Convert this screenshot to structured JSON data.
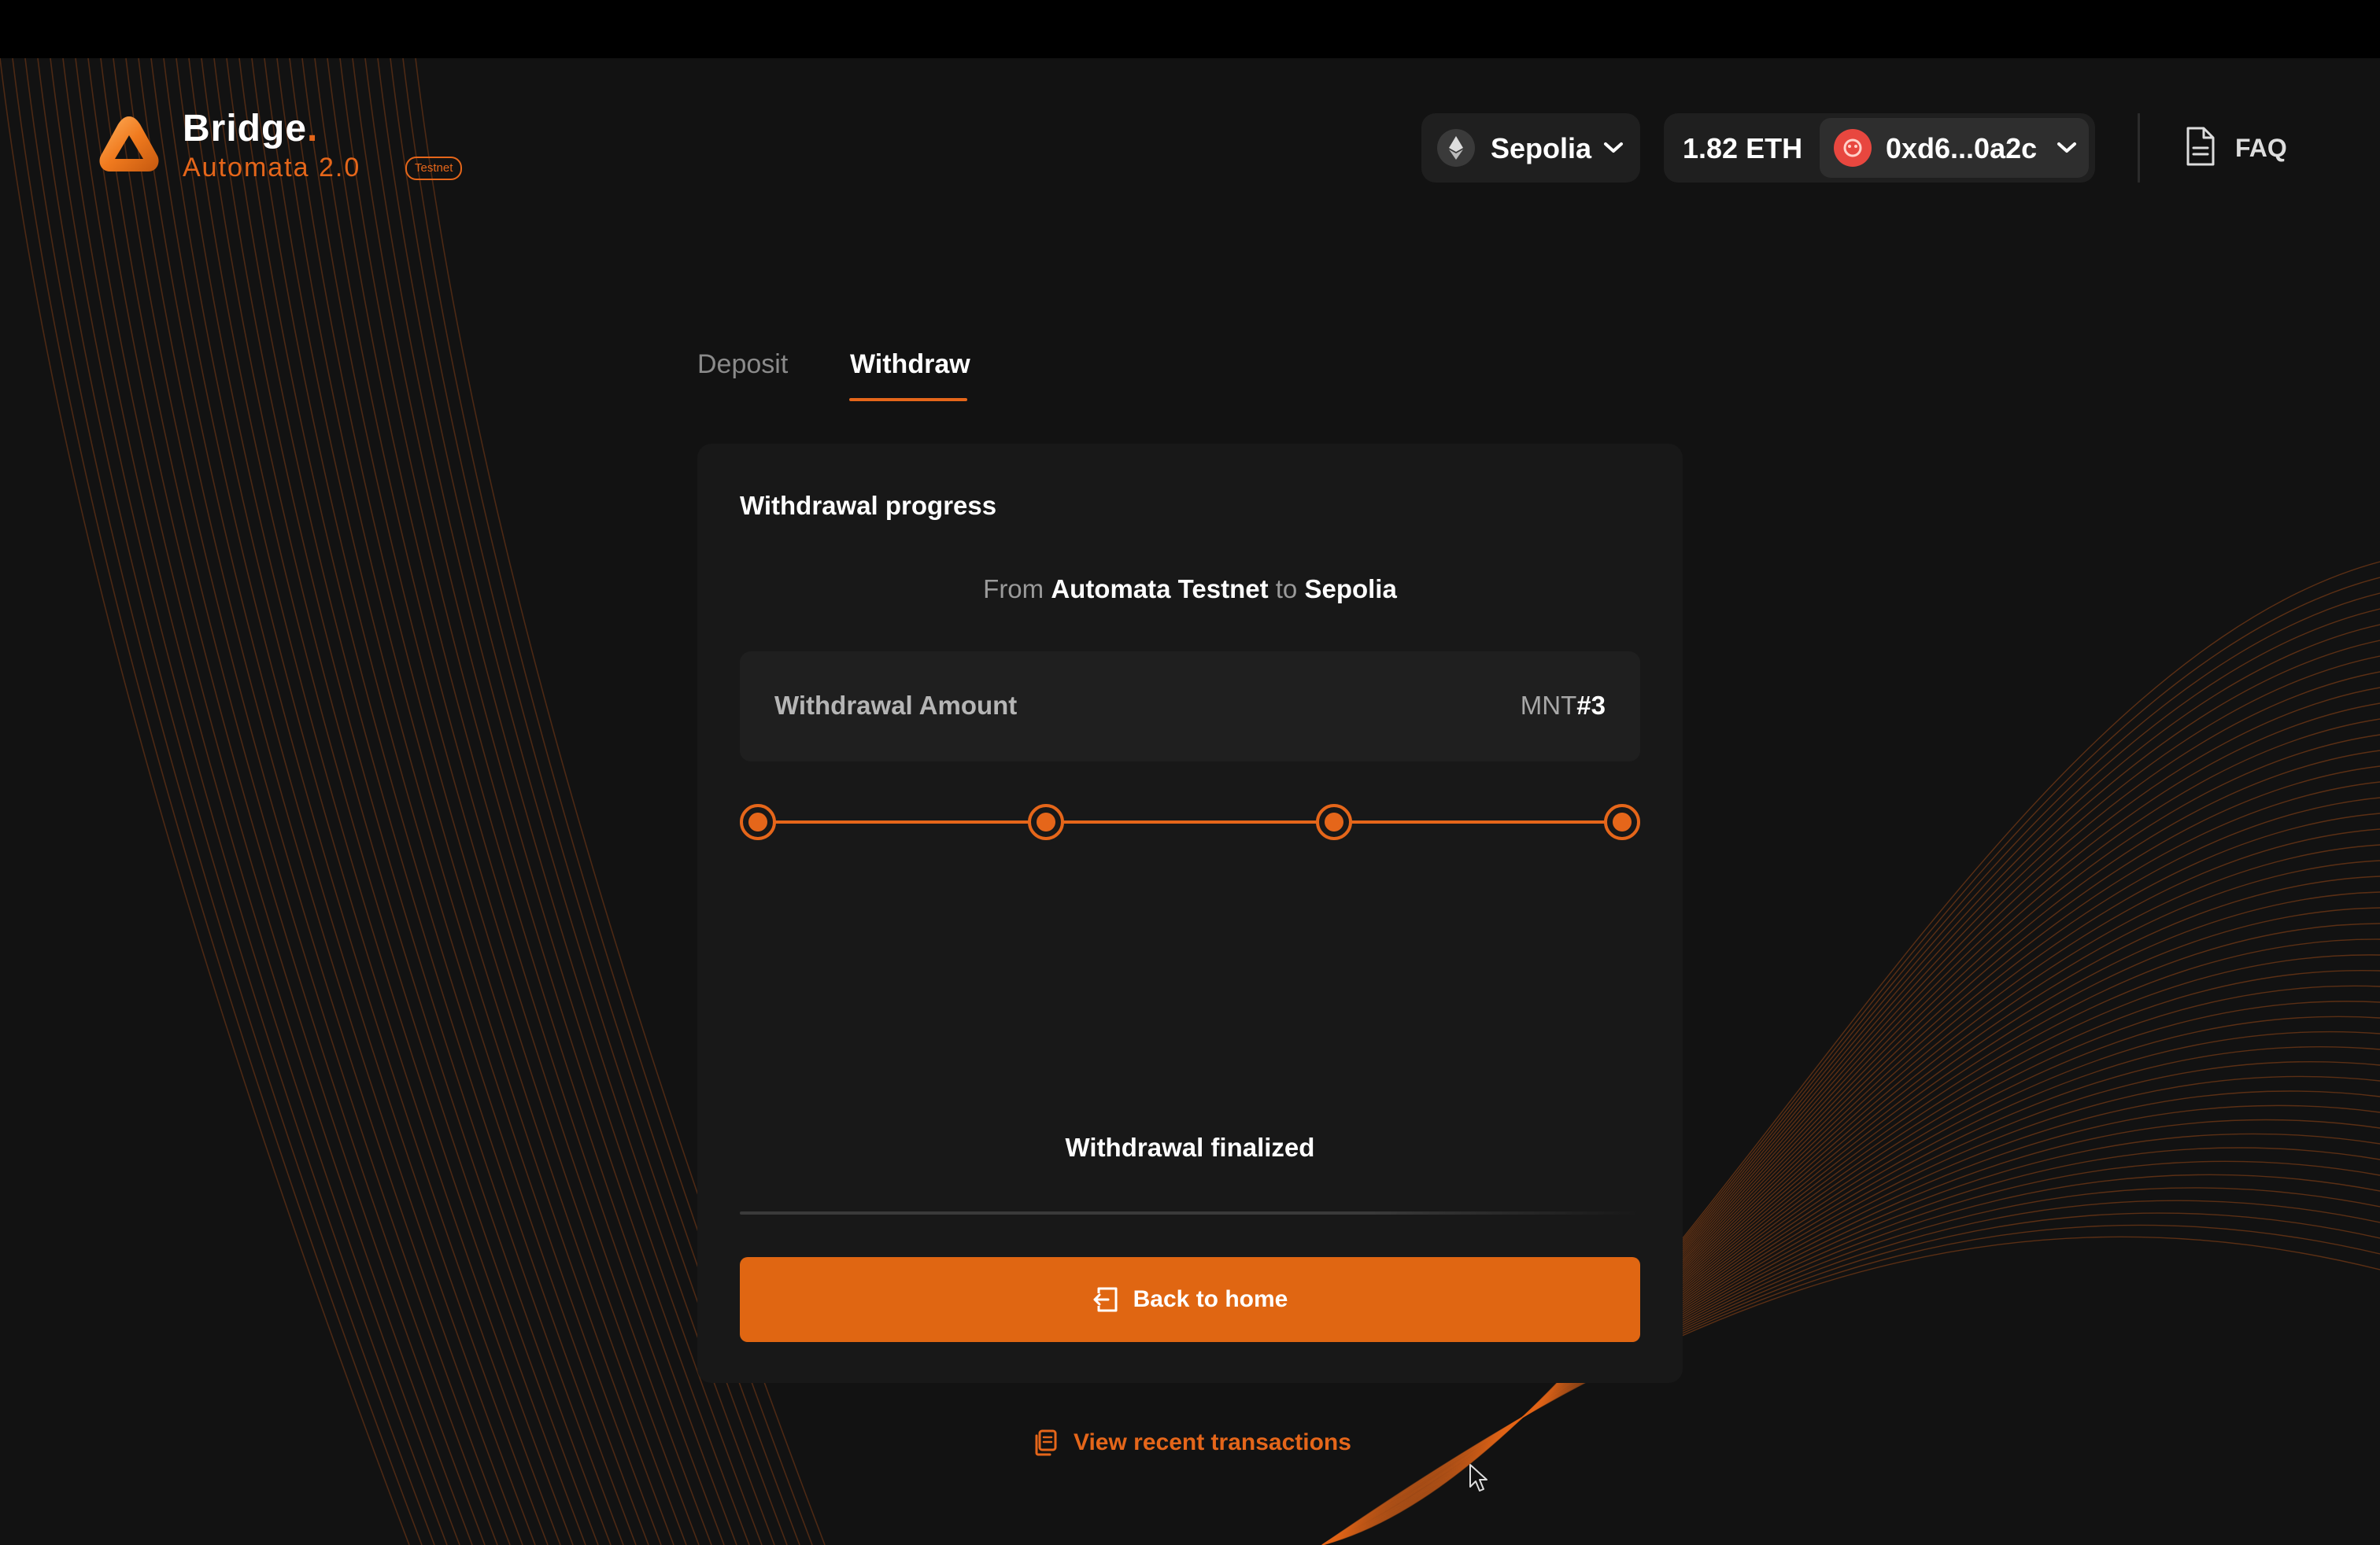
{
  "header": {
    "brand_title": "Bridge",
    "brand_dot": ".",
    "brand_subtitle": "Automata 2.0",
    "badge": "Testnet",
    "network": {
      "label": "Sepolia",
      "icon": "ethereum-icon"
    },
    "wallet": {
      "balance": "1.82 ETH",
      "address": "0xd6...0a2c",
      "icon": "avatar-icon"
    },
    "faq": {
      "label": "FAQ",
      "icon": "document-icon"
    }
  },
  "tabs": [
    {
      "label": "Deposit",
      "active": false
    },
    {
      "label": "Withdraw",
      "active": true
    }
  ],
  "card": {
    "title": "Withdrawal progress",
    "route": {
      "from_word": "From",
      "from": "Automata Testnet",
      "to_word": "to",
      "to": "Sepolia"
    },
    "amount": {
      "label": "Withdrawal Amount",
      "token": "MNT",
      "id": "#3"
    },
    "progress": {
      "steps_total": 4,
      "steps_completed": 4
    },
    "status": "Withdrawal finalized",
    "button": {
      "label": "Back to home",
      "icon": "exit-door-icon"
    }
  },
  "footer": {
    "recent_label": "View recent transactions",
    "recent_icon": "copy-icon"
  },
  "colors": {
    "accent": "#E5661A",
    "button": "#E06612",
    "background": "#121212",
    "card": "#181818"
  }
}
